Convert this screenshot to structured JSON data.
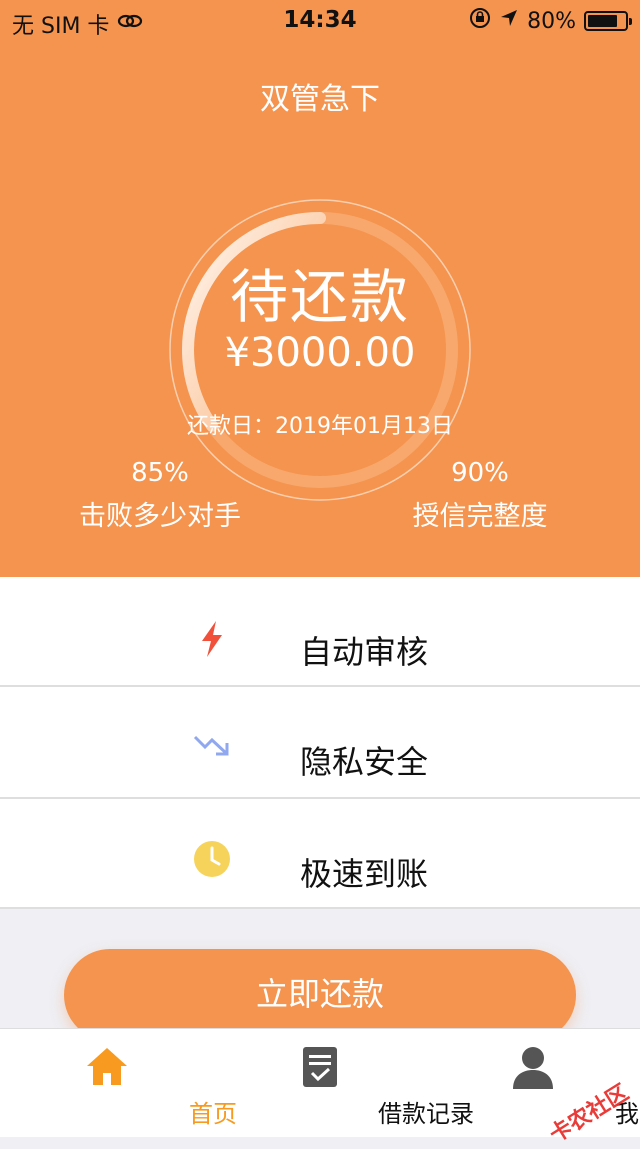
{
  "status_bar": {
    "carrier": "无 SIM 卡",
    "time": "14:34",
    "battery_percent": "80%",
    "battery_level": 0.8
  },
  "header": {
    "title": "双管急下",
    "status": "待还款",
    "amount": "¥3000.00",
    "due_date": "还款日：2019年01月13日",
    "progress": 0.7,
    "stats": [
      {
        "value": "85%",
        "label": "击败多少对手"
      },
      {
        "value": "90%",
        "label": "授信完整度"
      }
    ]
  },
  "features": [
    {
      "label": "自动审核",
      "icon": "lightning-icon",
      "color": "#f1503a"
    },
    {
      "label": "隐私安全",
      "icon": "trend-down-icon",
      "color": "#8fa8f0"
    },
    {
      "label": "极速到账",
      "icon": "clock-icon",
      "color": "#f6d35a"
    }
  ],
  "repay_button": {
    "label": "立即还款"
  },
  "tabs": [
    {
      "label": "首页",
      "icon": "home-icon",
      "active": true
    },
    {
      "label": "借款记录",
      "icon": "document-check-icon",
      "active": false
    },
    {
      "label": "我的",
      "icon": "user-icon",
      "active": false
    }
  ],
  "watermark": "卡农社区",
  "colors": {
    "brand": "#f4944f",
    "active_tab": "#f79a1f"
  }
}
